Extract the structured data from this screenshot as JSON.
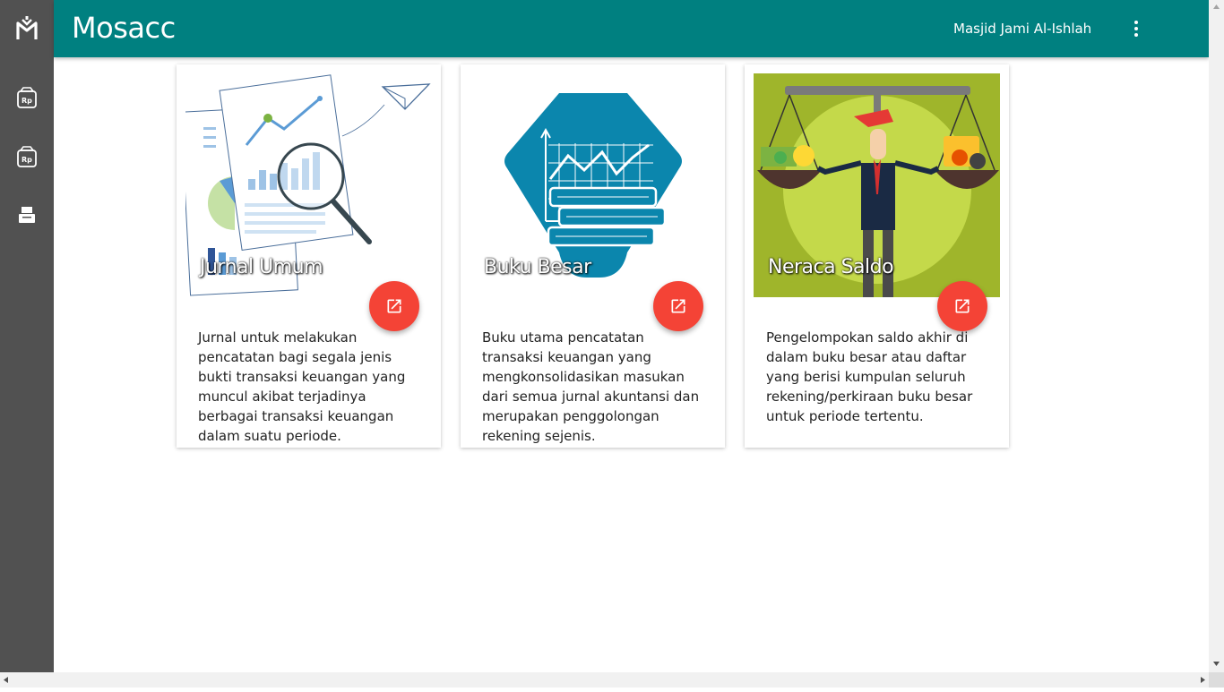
{
  "app": {
    "title": "Mosacc",
    "organization": "Masjid Jami Al-Ishlah"
  },
  "sidebar": {
    "items": [
      {
        "icon": "logo-icon"
      },
      {
        "icon": "bag-money-icon"
      },
      {
        "icon": "bag-money-icon"
      },
      {
        "icon": "printer-icon"
      }
    ]
  },
  "cards": [
    {
      "title": "Jurnal Umum",
      "description": "Jurnal untuk melakukan pencatatan bagi segala jenis bukti transaksi keuangan yang muncul akibat terjadinya berbagai transaksi keuangan dalam suatu periode.",
      "action_icon": "open-in-new-icon"
    },
    {
      "title": "Buku Besar",
      "description": "Buku utama pencatatan transaksi keuangan yang mengkonsolidasikan masukan dari semua jurnal akuntansi dan merupakan penggolongan rekening sejenis.",
      "action_icon": "open-in-new-icon"
    },
    {
      "title": "Neraca Saldo",
      "description": "Pengelompokan saldo akhir di dalam buku besar atau daftar yang berisi kumpulan seluruh rekening/perkiraan buku besar untuk periode tertentu.",
      "action_icon": "open-in-new-icon"
    }
  ],
  "colors": {
    "topbar": "#008080",
    "sidebar": "#515151",
    "fab": "#f44336",
    "buku_besar_hex": "#0b86ad",
    "neraca_bg": "#9fb52b"
  }
}
